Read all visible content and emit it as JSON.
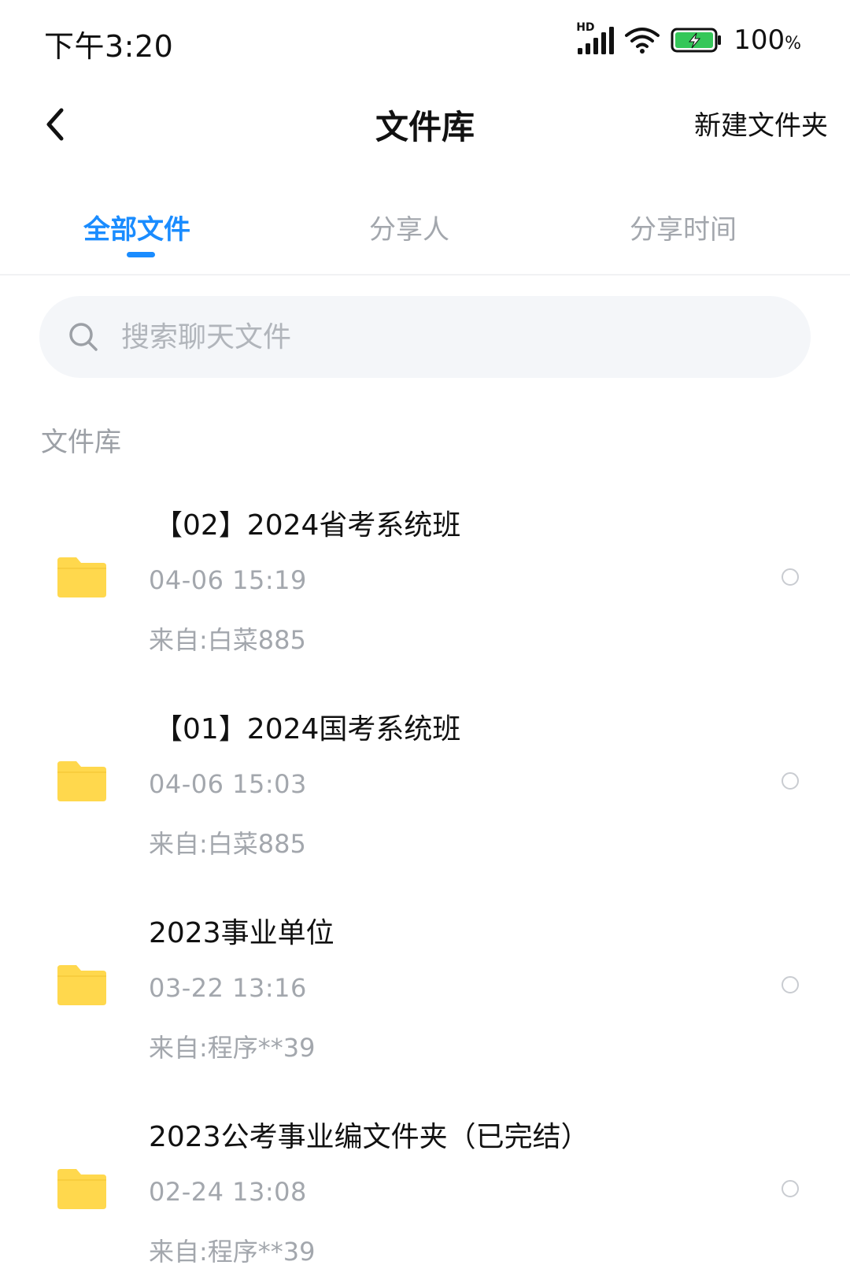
{
  "status_bar": {
    "time": "下午3:20",
    "battery_percent": "100",
    "battery_unit": "%",
    "network_label": "HD",
    "icons": [
      "signal-icon",
      "wifi-icon",
      "battery-charging-icon"
    ]
  },
  "nav": {
    "title": "文件库",
    "new_folder_label": "新建文件夹",
    "back_icon": "chevron-left-icon"
  },
  "tabs": [
    {
      "label": "全部文件",
      "active": true
    },
    {
      "label": "分享人",
      "active": false
    },
    {
      "label": "分享时间",
      "active": false
    }
  ],
  "search": {
    "placeholder": "搜索聊天文件",
    "value": ""
  },
  "section_title": "文件库",
  "files": [
    {
      "name": "【02】2024省考系统班",
      "time": "04-06  15:19",
      "source": "来自:白菜885",
      "icon": "folder-icon"
    },
    {
      "name": "【01】2024国考系统班",
      "time": "04-06  15:03",
      "source": "来自:白菜885",
      "icon": "folder-icon"
    },
    {
      "name": "2023事业单位",
      "time": "03-22  13:16",
      "source": "来自:程序**39",
      "icon": "folder-icon"
    },
    {
      "name": "2023公考事业编文件夹（已完结）",
      "time": "02-24  13:08",
      "source": "来自:程序**39",
      "icon": "folder-icon"
    }
  ],
  "colors": {
    "accent": "#1a8cff",
    "folder": "#ffd84d",
    "muted_text": "#a3a7ad",
    "search_bg": "#f4f6f9"
  }
}
